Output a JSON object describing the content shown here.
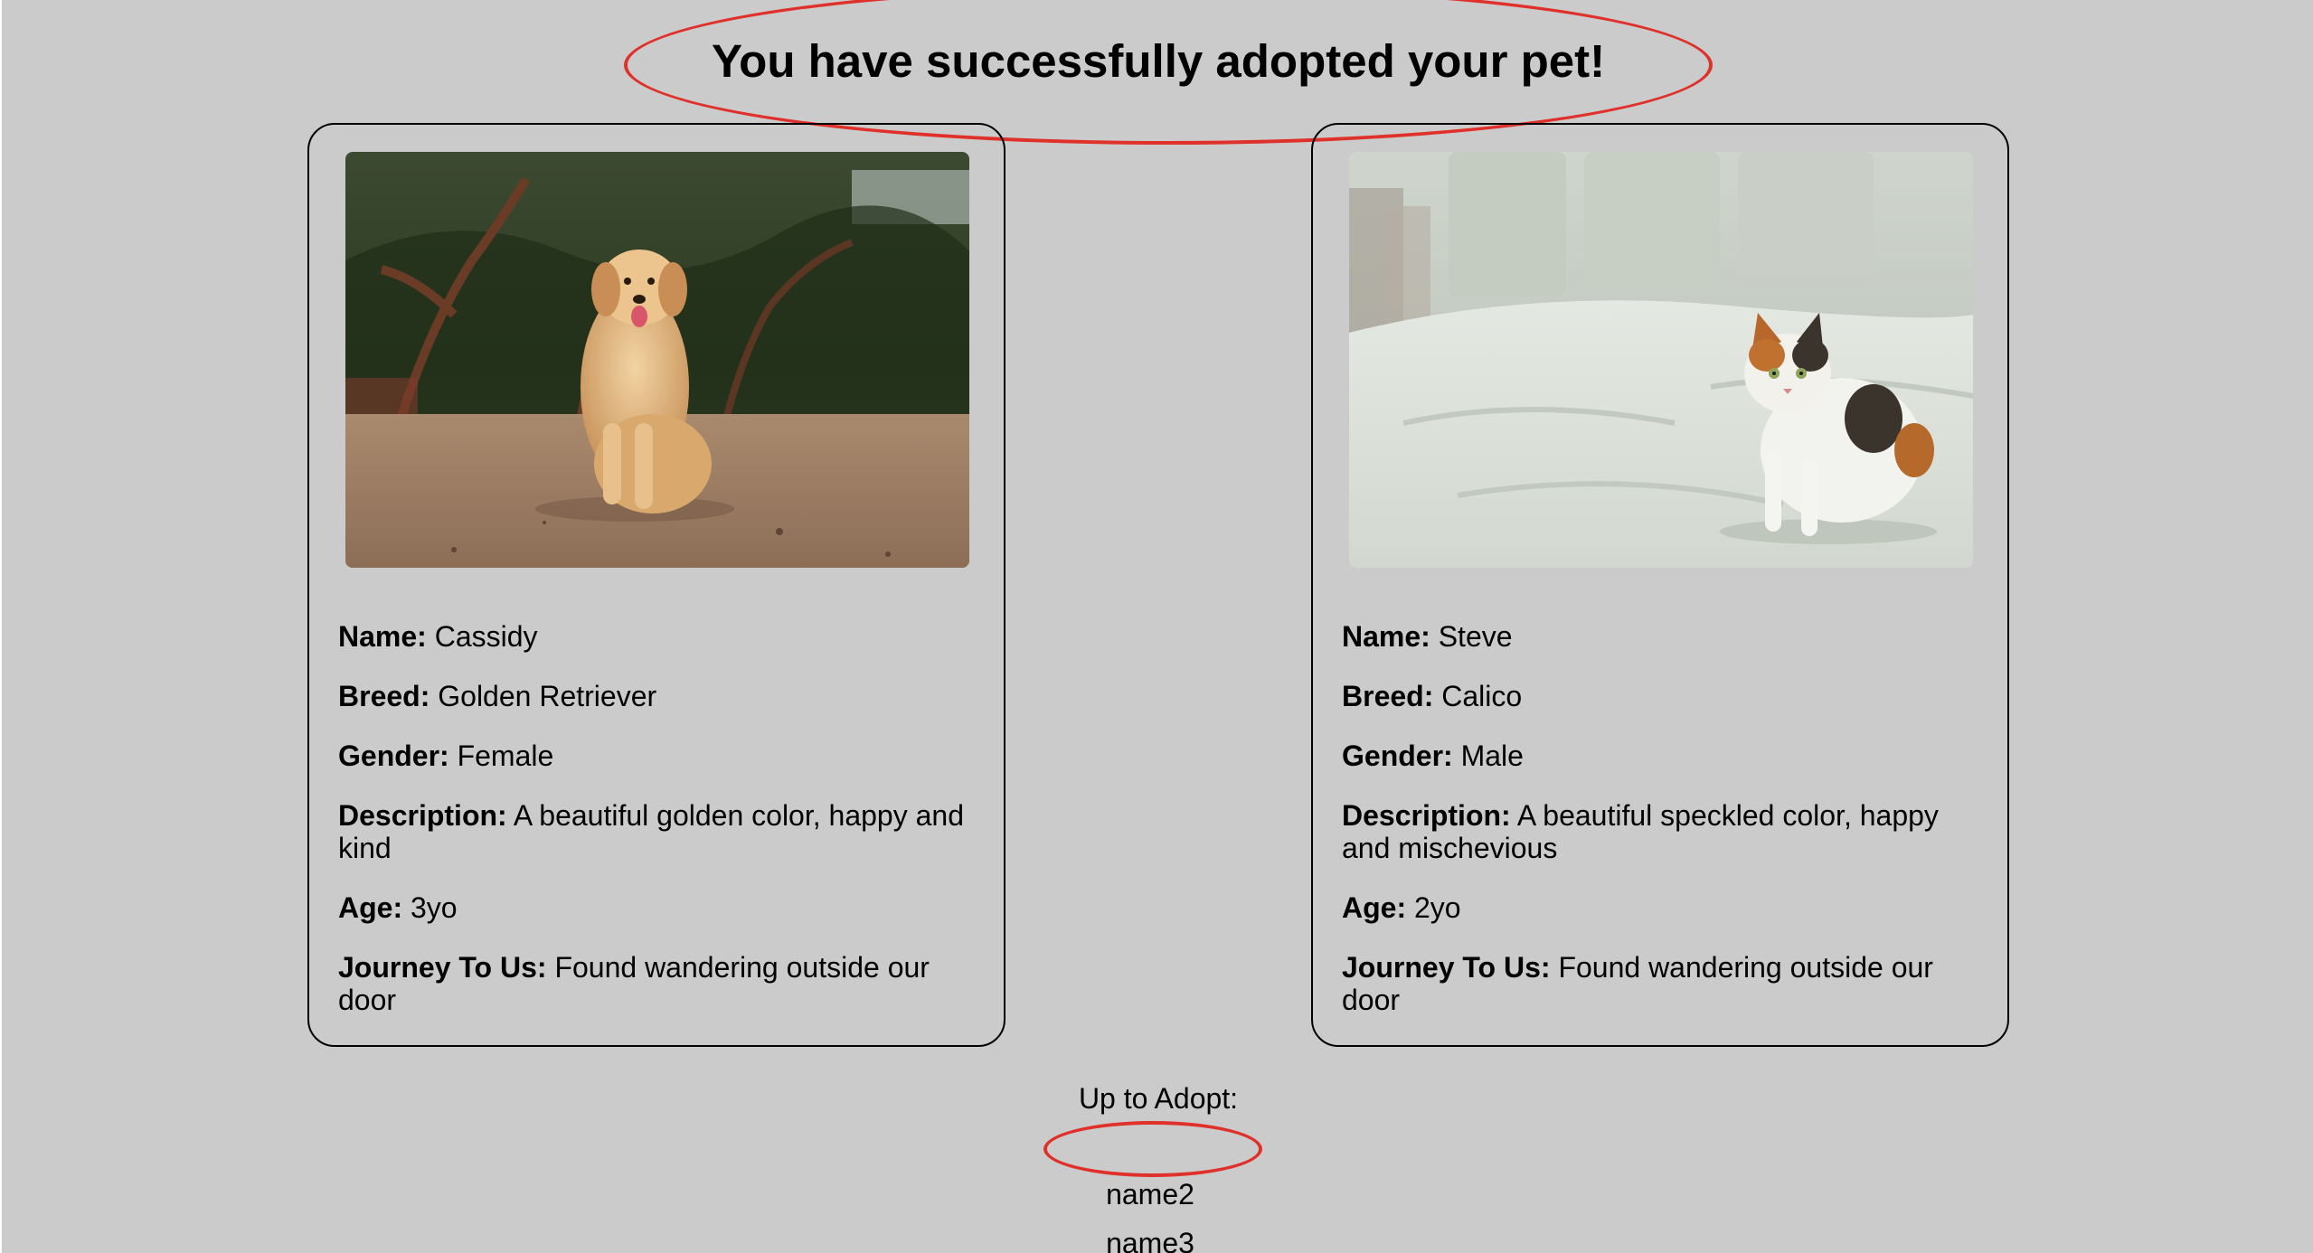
{
  "header": {
    "message": "You have successfully adopted your pet!"
  },
  "annotation_color": "#e0302a",
  "pets": [
    {
      "photo_icon": "golden-retriever-photo",
      "name_label": "Name:",
      "name": "Cassidy",
      "breed_label": "Breed:",
      "breed": "Golden Retriever",
      "gender_label": "Gender:",
      "gender": "Female",
      "description_label": "Description:",
      "description": "A beautiful golden color, happy and kind",
      "age_label": "Age:",
      "age": "3yo",
      "journey_label": "Journey To Us:",
      "journey": "Found wandering outside our door"
    },
    {
      "photo_icon": "calico-cat-photo",
      "name_label": "Name:",
      "name": "Steve",
      "breed_label": "Breed:",
      "breed": "Calico",
      "gender_label": "Gender:",
      "gender": "Male",
      "description_label": "Description:",
      "description": "A beautiful speckled color, happy and mischevious",
      "age_label": "Age:",
      "age": "2yo",
      "journey_label": "Journey To Us:",
      "journey": "Found wandering outside our door"
    }
  ],
  "adopt_section": {
    "title": "Up to Adopt:",
    "items": [
      "",
      "name2",
      "name3"
    ]
  }
}
